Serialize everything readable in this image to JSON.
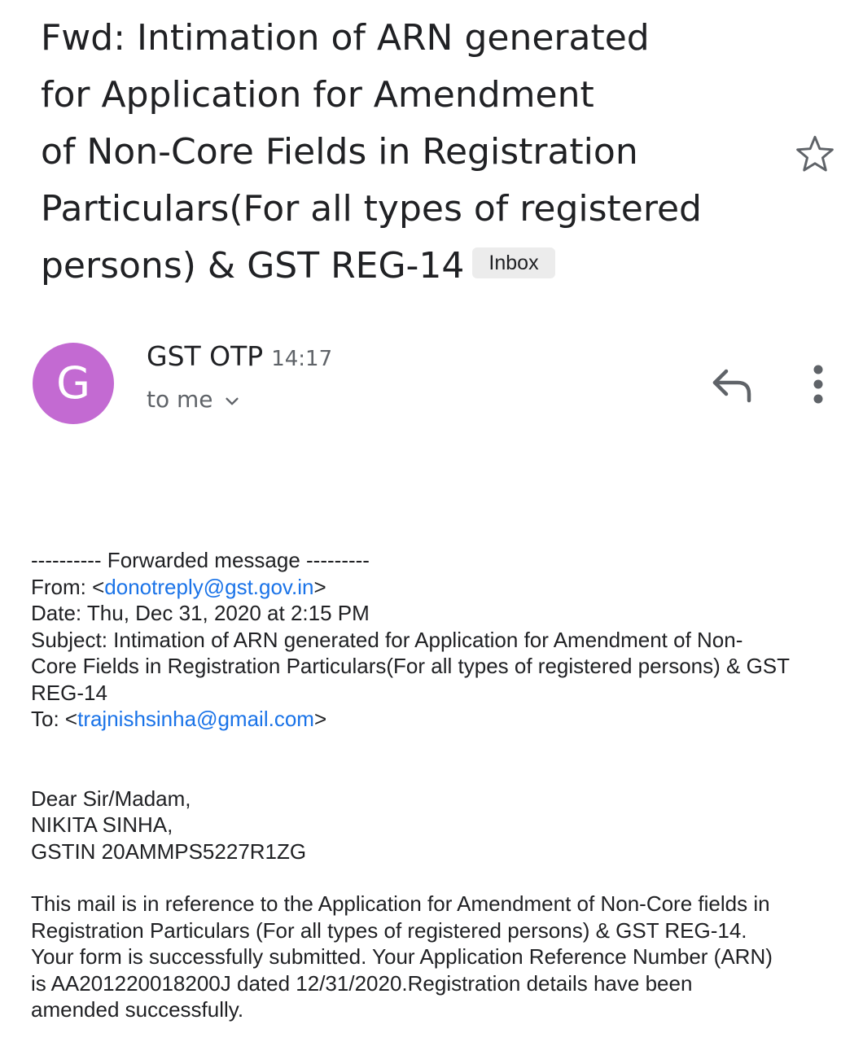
{
  "email": {
    "subject_lines": [
      "Fwd: Intimation of ARN generated",
      "for Application for Amendment",
      "of Non-Core Fields in Registration",
      "Particulars(For all types of registered",
      "persons) & GST REG-14"
    ],
    "label": "Inbox",
    "sender": {
      "initial": "G",
      "name": "GST OTP",
      "time": "14:17",
      "recipient": "to me",
      "avatar_color": "#c36ad2"
    },
    "forwarded": {
      "header": "---------- Forwarded message ---------",
      "from_label": "From: <",
      "from_email": "donotreply@gst.gov.in",
      "from_close": ">",
      "date": "Date: Thu, Dec 31, 2020 at 2:15 PM",
      "subject_line1": "Subject: Intimation of ARN generated for Application for Amendment of Non-",
      "subject_line2": "Core Fields in Registration Particulars(For all types of registered persons) & GST",
      "subject_line3": "REG-14",
      "to_label": "To: <",
      "to_email": "trajnishsinha@gmail.com",
      "to_close": ">"
    },
    "greeting": {
      "line1": "Dear Sir/Madam,",
      "line2": "NIKITA SINHA,",
      "line3": "GSTIN 20AMMPS5227R1ZG"
    },
    "message": {
      "line1": "This mail is in reference to the Application for Amendment of Non-Core fields in",
      "line2": "Registration Particulars (For all types of registered persons) & GST REG-14.",
      "line3": "Your form is successfully submitted. Your Application Reference Number (ARN)",
      "line4": "is AA201220018200J dated 12/31/2020.Registration details have been",
      "line5": "amended successfully."
    }
  },
  "icons": {
    "star": "star-outline-icon",
    "reply": "reply-icon",
    "more": "more-vertical-icon",
    "chevron": "chevron-down-icon"
  },
  "colors": {
    "link": "#1a73e8",
    "chip_background": "#ececec"
  }
}
